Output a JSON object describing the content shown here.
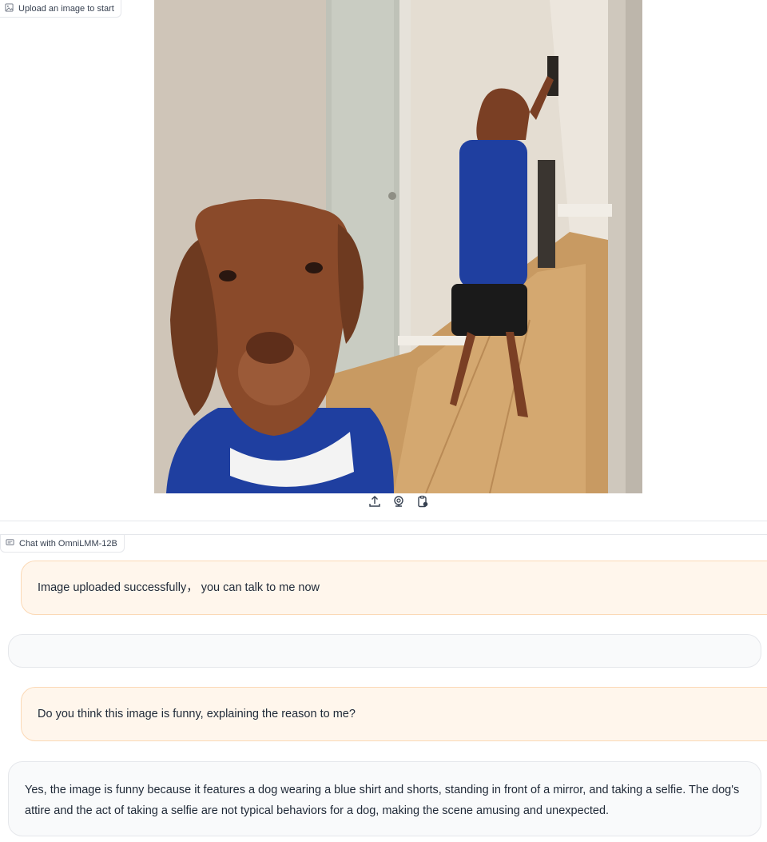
{
  "image_panel": {
    "label": "Upload an image to start",
    "tools": [
      {
        "name": "upload-icon"
      },
      {
        "name": "webcam-icon"
      },
      {
        "name": "clipboard-icon"
      }
    ]
  },
  "chat_panel": {
    "label": "Chat with OmniLMM-12B",
    "messages": [
      {
        "role": "user",
        "text": "Image uploaded successfully，  you can talk to me now"
      },
      {
        "role": "assistant",
        "text": ""
      },
      {
        "role": "user",
        "text": "Do you think this image is funny, explaining the reason to me?"
      },
      {
        "role": "assistant",
        "text": "Yes, the image is funny because it features a dog wearing a blue shirt and shorts, standing in front of a mirror, and taking a selfie. The dog's attire and the act of taking a selfie are not typical behaviors for a dog, making the scene amusing and unexpected."
      }
    ]
  },
  "colors": {
    "user_bubble": "#fff6ec",
    "user_border": "#fbd9b6",
    "bot_bubble": "#f9fafb",
    "shirt_blue": "#1f3fa0",
    "dog_brown": "#8a4a2a"
  }
}
